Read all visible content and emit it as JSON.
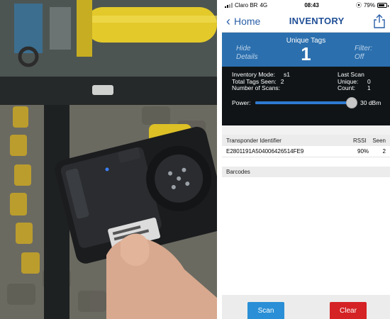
{
  "status_bar": {
    "carrier": "Claro BR",
    "network": "4G",
    "time": "08:43",
    "battery": "79%",
    "battery_level": 0.79
  },
  "nav": {
    "back_label": "Home",
    "title": "INVENTORY"
  },
  "tags_bar": {
    "label": "Unique Tags",
    "count": "1",
    "hide_details": "Hide Details",
    "filter": "Filter: Off"
  },
  "info": {
    "mode_label": "Inventory Mode:",
    "mode_value": "s1",
    "total_seen_label": "Total Tags Seen:",
    "total_seen_value": "2",
    "scans_label": "Number of Scans:",
    "last_scan_label": "Last Scan",
    "unique_label": "Unique:",
    "unique_value": "0",
    "count_label": "Count:",
    "count_value": "1",
    "power_label": "Power:",
    "power_value": "30 dBm",
    "power_level": 1.0
  },
  "table": {
    "columns": [
      "Transponder Identifier",
      "RSSI",
      "Seen"
    ],
    "rows": [
      {
        "id": "E2801191A504006426514FE9",
        "rssi": "90%",
        "seen": "2"
      }
    ]
  },
  "barcodes": {
    "header": "Barcodes"
  },
  "footer": {
    "scan_label": "Scan",
    "clear_label": "Clear"
  },
  "colors": {
    "accent_blue": "#2b6fae",
    "nav_blue": "#1f4e96",
    "scan_button": "#2a8fd6",
    "clear_button": "#d52224",
    "info_bg": "#101417"
  }
}
